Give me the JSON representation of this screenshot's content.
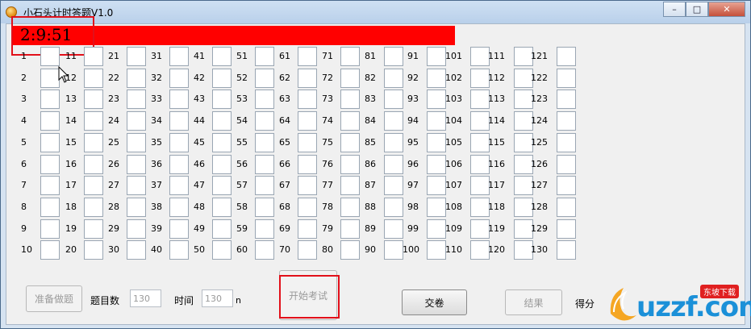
{
  "window": {
    "title": "小石头计时答题V1.0",
    "minimize_glyph": "–",
    "maximize_glyph": "□",
    "close_glyph": "✕"
  },
  "timer": {
    "text": "2:9:51",
    "bar_color": "#ff0000"
  },
  "questions": {
    "columns": [
      [
        1,
        2,
        3,
        4,
        5,
        6,
        7,
        8,
        9,
        10
      ],
      [
        11,
        12,
        13,
        14,
        15,
        16,
        17,
        18,
        19,
        20
      ],
      [
        21,
        22,
        23,
        24,
        25,
        26,
        27,
        28,
        29,
        30
      ],
      [
        31,
        32,
        33,
        34,
        35,
        36,
        37,
        38,
        39,
        40
      ],
      [
        41,
        42,
        43,
        44,
        45,
        46,
        47,
        48,
        49,
        50
      ],
      [
        51,
        52,
        53,
        54,
        55,
        56,
        57,
        58,
        59,
        60
      ],
      [
        61,
        62,
        63,
        64,
        65,
        66,
        67,
        68,
        69,
        70
      ],
      [
        71,
        72,
        73,
        74,
        75,
        76,
        77,
        78,
        79,
        80
      ],
      [
        81,
        82,
        83,
        84,
        85,
        86,
        87,
        88,
        89,
        90
      ],
      [
        91,
        92,
        93,
        94,
        95,
        96,
        97,
        98,
        99,
        100
      ],
      [
        101,
        102,
        103,
        104,
        105,
        106,
        107,
        108,
        109,
        110
      ],
      [
        111,
        112,
        113,
        114,
        115,
        116,
        117,
        118,
        119,
        120
      ],
      [
        121,
        122,
        123,
        124,
        125,
        126,
        127,
        128,
        129,
        130
      ]
    ]
  },
  "controls": {
    "prepare_label": "准备做题",
    "count_label": "题目数",
    "count_value": "130",
    "time_label": "时间",
    "time_value": "130",
    "time_unit": "n",
    "start_label": "开始考试",
    "submit_label": "交卷",
    "result_label": "结果",
    "score_label": "得分"
  },
  "watermark": {
    "text": "uzzf.com",
    "badge": "东坡下载"
  },
  "colors": {
    "highlight": "#e2101a",
    "accent": "#1b90d8"
  }
}
